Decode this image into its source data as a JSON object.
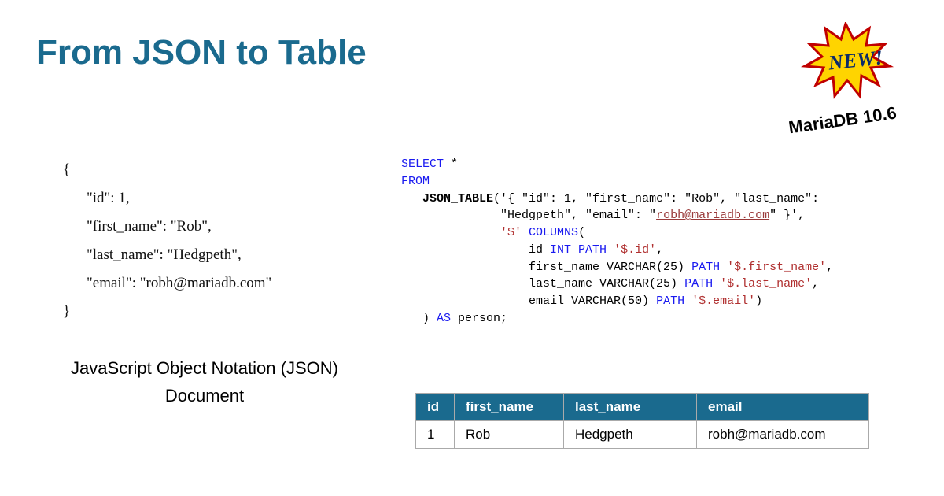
{
  "title": "From JSON to Table",
  "badge": {
    "text": "NEW!",
    "version": "MariaDB 10.6"
  },
  "json_doc": {
    "open": "{",
    "lines": [
      "\"id\": 1,",
      "\"first_name\": \"Rob\",",
      "\"last_name\": \"Hedgpeth\",",
      "\"email\": \"robh@mariadb.com\""
    ],
    "close": "}",
    "caption_line1": "JavaScript Object Notation (JSON)",
    "caption_line2": "Document"
  },
  "sql": {
    "select": "SELECT",
    "star": " *",
    "from": "FROM",
    "fn": "JSON_TABLE",
    "arg_open": "('{ \"id\": 1, \"first_name\": \"Rob\", \"last_name\":",
    "arg_cont": "\"Hedgpeth\", \"email\": \"",
    "email": "robh@mariadb.com",
    "arg_cont2": "\" }'",
    "arg_comma": ",",
    "root": "'$'",
    "columns_kw": " COLUMNS",
    "columns_paren": "(",
    "col_id_a": "id ",
    "col_id_b": "INT PATH",
    "col_id_c": " '$.id'",
    "col_id_d": ",",
    "col_fn_a": "first_name VARCHAR(25) ",
    "col_fn_b": "PATH",
    "col_fn_c": " '$.first_name'",
    "col_fn_d": ",",
    "col_ln_a": "last_name VARCHAR(25) ",
    "col_ln_b": "PATH",
    "col_ln_c": " '$.last_name'",
    "col_ln_d": ",",
    "col_em_a": "email VARCHAR(50) ",
    "col_em_b": "PATH",
    "col_em_c": " '$.email'",
    "col_em_d": ")",
    "close": ") ",
    "as": "AS",
    "alias": " person;"
  },
  "table": {
    "headers": [
      "id",
      "first_name",
      "last_name",
      "email"
    ],
    "row": [
      "1",
      "Rob",
      "Hedgpeth",
      "robh@mariadb.com"
    ]
  }
}
